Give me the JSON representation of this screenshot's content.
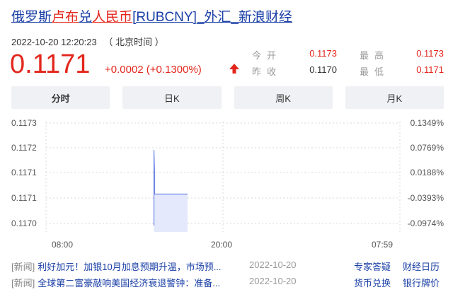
{
  "header": {
    "title_part1": "俄罗斯",
    "title_part2": "卢布",
    "title_part3": "兑",
    "title_part4": "人民币",
    "title_part5": "[RUBCNY]_外汇_新浪财经",
    "datetime": "2022-10-20 12:20:23",
    "timezone": "（ 北京时间 ）"
  },
  "quote": {
    "price": "0.1171",
    "change": "+0.0002 (+0.1300%)",
    "open_label": "今开",
    "open_value": "0.1173",
    "high_label": "最高",
    "high_value": "0.1173",
    "prev_close_label": "昨收",
    "prev_close_value": "0.1170",
    "low_label": "最低",
    "low_value": "0.1171"
  },
  "tabs": [
    {
      "label": "分时",
      "active": true
    },
    {
      "label": "日K",
      "active": false
    },
    {
      "label": "周K",
      "active": false
    },
    {
      "label": "月K",
      "active": false
    }
  ],
  "chart_data": {
    "type": "line",
    "y_left_ticks": [
      "0.1173",
      "0.1172",
      "0.1171",
      "0.1171",
      "0.1170"
    ],
    "y_right_ticks": [
      "0.1349%",
      "0.0769%",
      "0.0188%",
      "-0.0393%",
      "-0.0974%"
    ],
    "x_ticks": [
      "08:00",
      "20:00",
      "07:59"
    ],
    "ylim": [
      0.11698,
      0.11733
    ],
    "series": [
      {
        "values": [
          {
            "t": 0.305,
            "v": 0.117
          },
          {
            "t": 0.305,
            "v": 0.11724
          },
          {
            "t": 0.307,
            "v": 0.11716
          },
          {
            "t": 0.307,
            "v": 0.1171
          },
          {
            "t": 0.4,
            "v": 0.1171
          }
        ]
      }
    ],
    "colors": {
      "line": "#6e86e6",
      "fill": "#e4e9fb",
      "grid": "#d8d8d8"
    }
  },
  "news": [
    {
      "tag": "[新闻]",
      "title": "利好加元！加银10月加息预期升温，市场预...",
      "date": "2022-10-20"
    },
    {
      "tag": "[新闻]",
      "title": "全球第二富豪敲响美国经济衰退警钟：准备...",
      "date": "2022-10-20"
    }
  ],
  "links": {
    "expert": "专家答疑",
    "calendar": "财经日历",
    "exchange": "货币兑换",
    "bank": "银行牌价"
  }
}
